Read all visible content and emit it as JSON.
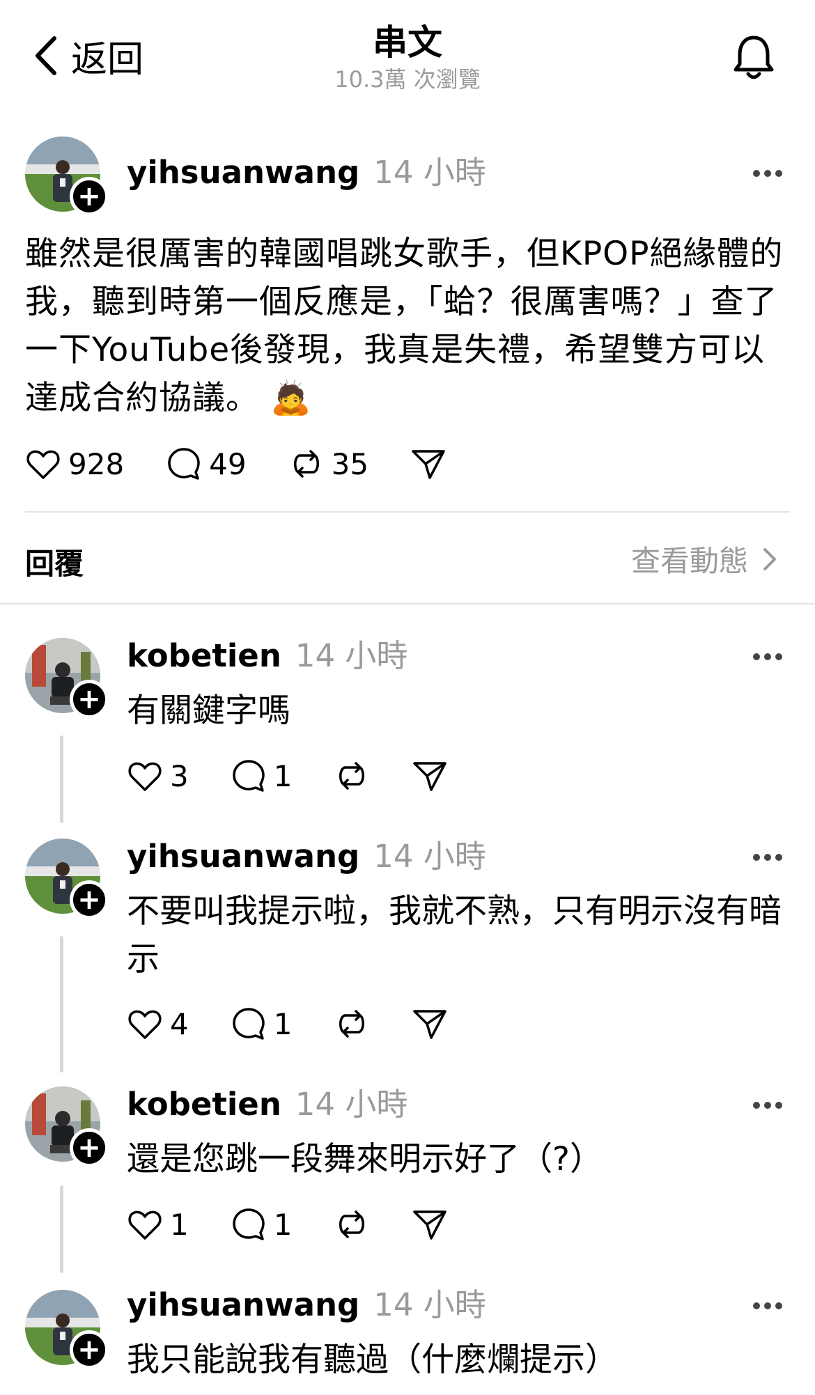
{
  "header": {
    "back_label": "返回",
    "title": "串文",
    "views": "10.3萬 次瀏覽"
  },
  "post": {
    "username": "yihsuanwang",
    "time": "14 小時",
    "text": "雖然是很厲害的韓國唱跳女歌手，但KPOP絕緣體的我，聽到時第一個反應是，「蛤？很厲害嗎？」查了一下YouTube後發現，我真是失禮，希望雙方可以達成合約協議。 🙇",
    "likes": "928",
    "comments": "49",
    "reposts": "35"
  },
  "replies_header": {
    "label": "回覆",
    "activity": "查看動態"
  },
  "replies": [
    {
      "username": "kobetien",
      "time": "14 小時",
      "text": "有關鍵字嗎",
      "likes": "3",
      "comments": "1"
    },
    {
      "username": "yihsuanwang",
      "time": "14 小時",
      "text": "不要叫我提示啦，我就不熟，只有明示沒有暗示",
      "likes": "4",
      "comments": "1"
    },
    {
      "username": "kobetien",
      "time": "14 小時",
      "text": "還是您跳一段舞來明示好了（?）",
      "likes": "1",
      "comments": "1"
    },
    {
      "username": "yihsuanwang",
      "time": "14 小時",
      "text": "我只能說我有聽過（什麼爛提示）"
    }
  ],
  "icons": [
    "chevron-left-icon",
    "bell-icon",
    "heart-icon",
    "comment-icon",
    "repost-icon",
    "share-icon",
    "more-icon",
    "plus-icon"
  ]
}
